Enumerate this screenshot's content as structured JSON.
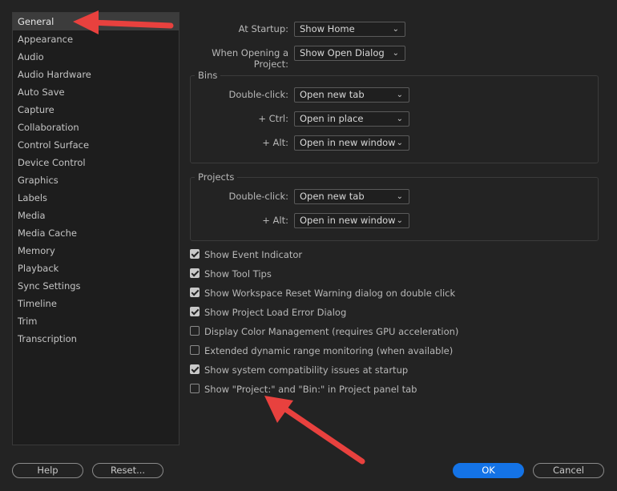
{
  "sidebar": {
    "items": [
      {
        "label": "General",
        "selected": true
      },
      {
        "label": "Appearance"
      },
      {
        "label": "Audio"
      },
      {
        "label": "Audio Hardware"
      },
      {
        "label": "Auto Save"
      },
      {
        "label": "Capture"
      },
      {
        "label": "Collaboration"
      },
      {
        "label": "Control Surface"
      },
      {
        "label": "Device Control"
      },
      {
        "label": "Graphics"
      },
      {
        "label": "Labels"
      },
      {
        "label": "Media"
      },
      {
        "label": "Media Cache"
      },
      {
        "label": "Memory"
      },
      {
        "label": "Playback"
      },
      {
        "label": "Sync Settings"
      },
      {
        "label": "Timeline"
      },
      {
        "label": "Trim"
      },
      {
        "label": "Transcription"
      }
    ]
  },
  "general": {
    "at_startup": {
      "label": "At Startup:",
      "value": "Show Home"
    },
    "when_opening": {
      "label": "When Opening a Project:",
      "value": "Show Open Dialog"
    }
  },
  "bins": {
    "title": "Bins",
    "double_click": {
      "label": "Double-click:",
      "value": "Open new tab"
    },
    "ctrl": {
      "label": "+ Ctrl:",
      "value": "Open in place"
    },
    "alt": {
      "label": "+ Alt:",
      "value": "Open in new window"
    }
  },
  "projects": {
    "title": "Projects",
    "double_click": {
      "label": "Double-click:",
      "value": "Open new tab"
    },
    "alt": {
      "label": "+ Alt:",
      "value": "Open in new window"
    }
  },
  "checkboxes": [
    {
      "label": "Show Event Indicator",
      "checked": true
    },
    {
      "label": "Show Tool Tips",
      "checked": true
    },
    {
      "label": "Show Workspace Reset Warning dialog on double click",
      "checked": true
    },
    {
      "label": "Show Project Load Error Dialog",
      "checked": true
    },
    {
      "label": "Display Color Management (requires GPU acceleration)",
      "checked": false
    },
    {
      "label": "Extended dynamic range monitoring (when available)",
      "checked": false
    },
    {
      "label": "Show system compatibility issues at startup",
      "checked": true
    },
    {
      "label": "Show \"Project:\" and \"Bin:\" in Project panel tab",
      "checked": false
    }
  ],
  "buttons": {
    "help": "Help",
    "reset": "Reset...",
    "ok": "OK",
    "cancel": "Cancel"
  },
  "colors": {
    "accent": "#1473e6",
    "annotation_arrow": "#e8413e"
  },
  "icons": {
    "dropdown": "chevron-down-icon",
    "checkbox": "checkbox-icon"
  }
}
